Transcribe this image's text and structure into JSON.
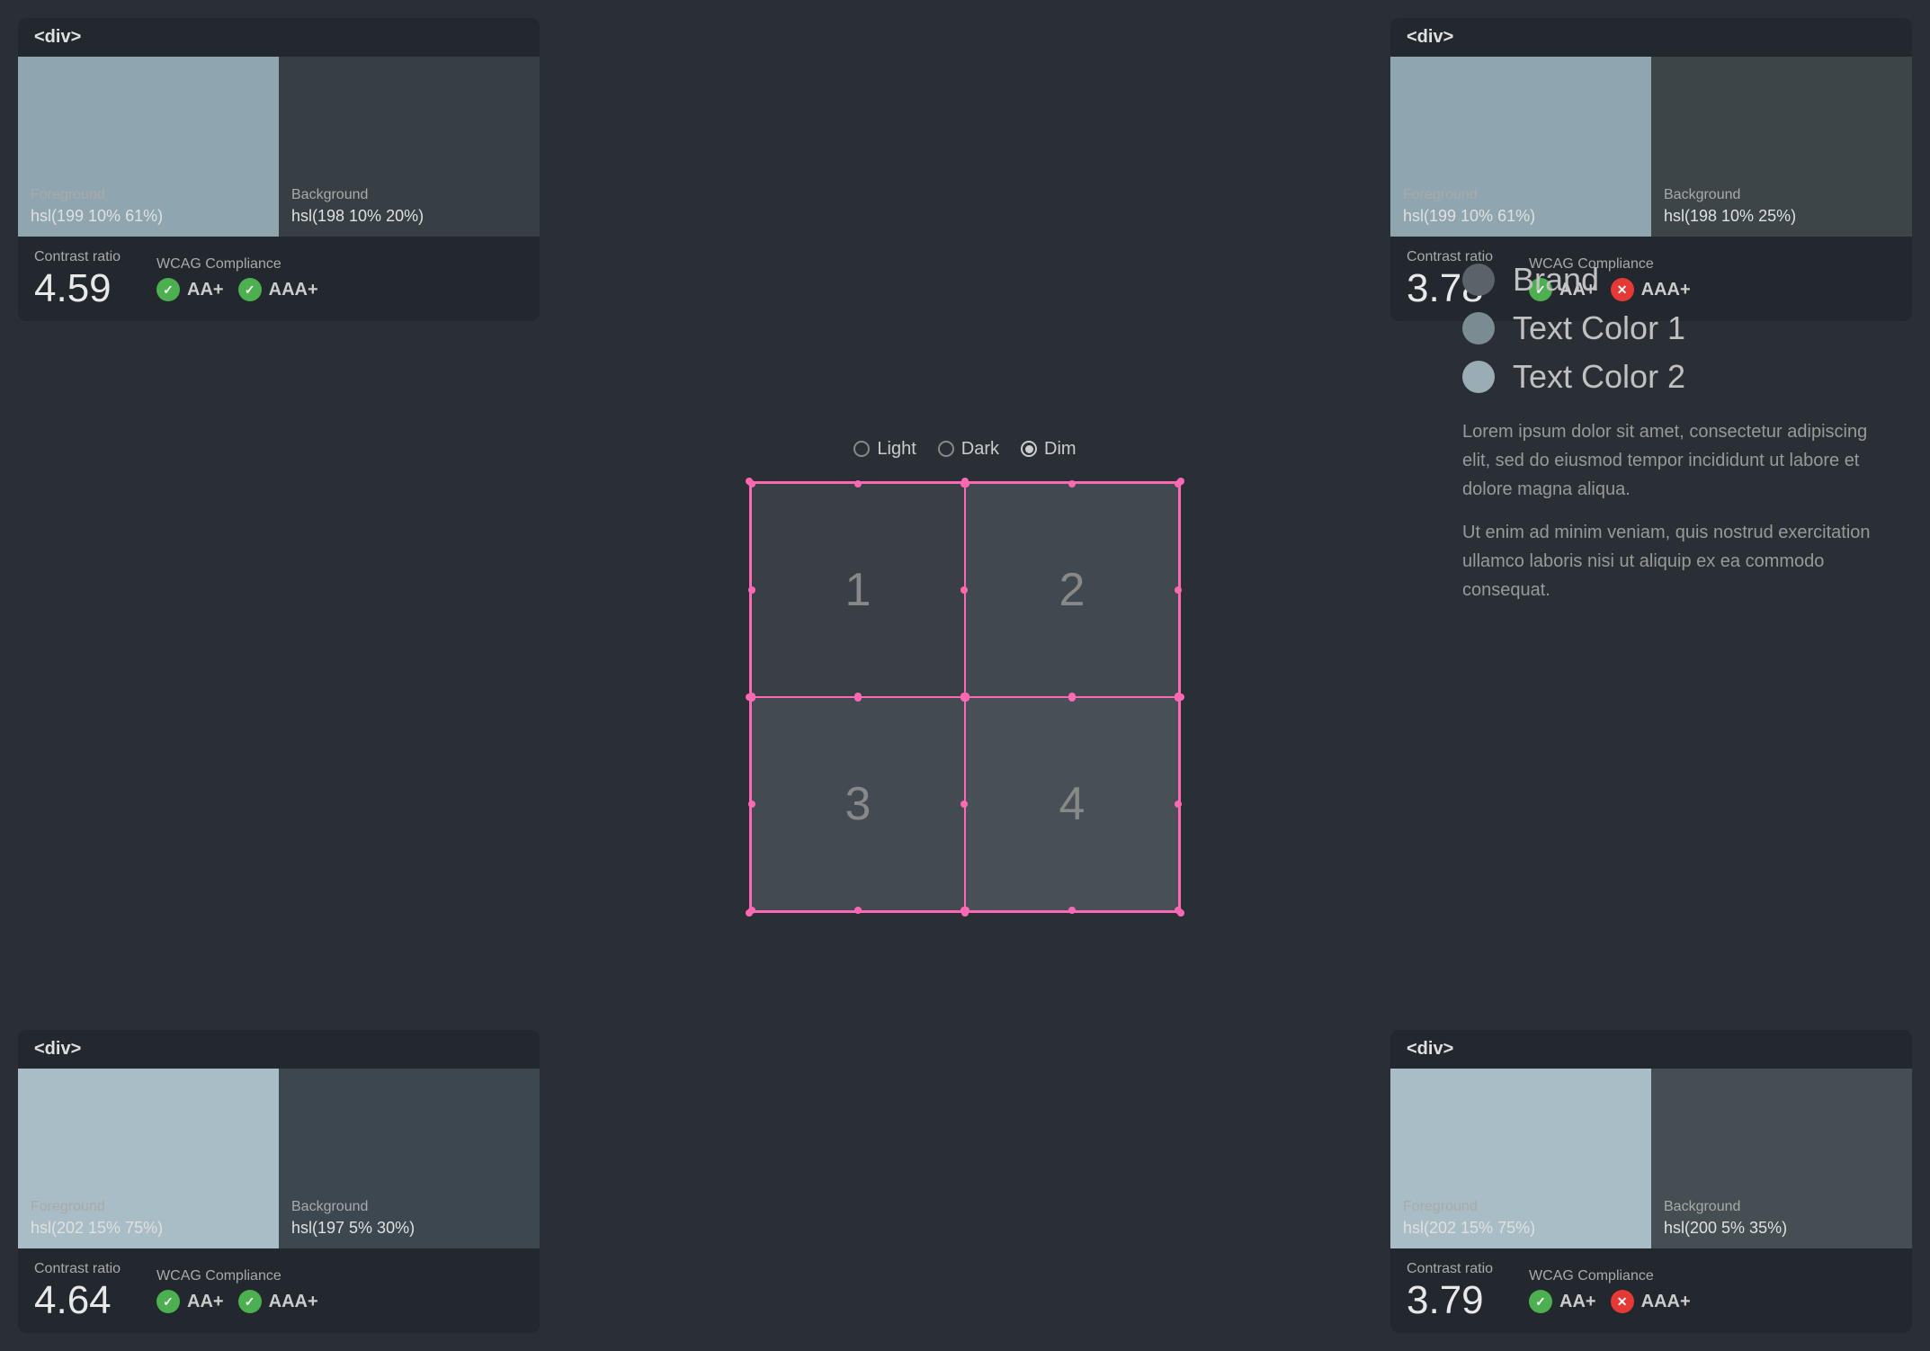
{
  "cards": {
    "top_left": {
      "tag": "<div>",
      "fg_label": "Foreground",
      "fg_value": "hsl(199 10% 61%)",
      "bg_label": "Background",
      "bg_value": "hsl(198 10% 20%)",
      "contrast_label": "Contrast ratio",
      "contrast_value": "4.59",
      "wcag_label": "WCAG Compliance",
      "aa_label": "AA+",
      "aaa_label": "AAA+",
      "aa_pass": true,
      "aaa_pass": true
    },
    "top_right": {
      "tag": "<div>",
      "fg_label": "Foreground",
      "fg_value": "hsl(199 10% 61%)",
      "bg_label": "Background",
      "bg_value": "hsl(198 10% 25%)",
      "contrast_label": "Contrast ratio",
      "contrast_value": "3.78",
      "wcag_label": "WCAG Compliance",
      "aa_label": "AA+",
      "aaa_label": "AAA+",
      "aa_pass": true,
      "aaa_pass": false
    },
    "bottom_left": {
      "tag": "<div>",
      "fg_label": "Foreground",
      "fg_value": "hsl(202 15% 75%)",
      "bg_label": "Background",
      "bg_value": "hsl(197 5% 30%)",
      "contrast_label": "Contrast ratio",
      "contrast_value": "4.64",
      "wcag_label": "WCAG Compliance",
      "aa_label": "AA+",
      "aaa_label": "AAA+",
      "aa_pass": true,
      "aaa_pass": true
    },
    "bottom_right": {
      "tag": "<div>",
      "fg_label": "Foreground",
      "fg_value": "hsl(202 15% 75%)",
      "bg_label": "Background",
      "bg_value": "hsl(200 5% 35%)",
      "contrast_label": "Contrast ratio",
      "contrast_value": "3.79",
      "wcag_label": "WCAG Compliance",
      "aa_label": "AA+",
      "aaa_label": "AAA+",
      "aa_pass": true,
      "aaa_pass": false
    }
  },
  "theme": {
    "options": [
      "Light",
      "Dark",
      "Dim"
    ],
    "selected": "Dim"
  },
  "grid": {
    "cells": [
      "1",
      "2",
      "3",
      "4"
    ]
  },
  "legend": {
    "items": [
      {
        "label": "Brand",
        "color": "#5a6368"
      },
      {
        "label": "Text Color 1",
        "color": "#7a8b92"
      },
      {
        "label": "Text Color 2",
        "color": "#9aadb5"
      }
    ]
  },
  "lorem": {
    "p1": "Lorem ipsum dolor sit amet, consectetur adipiscing elit, sed do eiusmod tempor incididunt ut labore et dolore magna aliqua.",
    "p2": "Ut enim ad minim veniam, quis nostrud exercitation ullamco laboris nisi ut aliquip ex ea commodo consequat."
  }
}
